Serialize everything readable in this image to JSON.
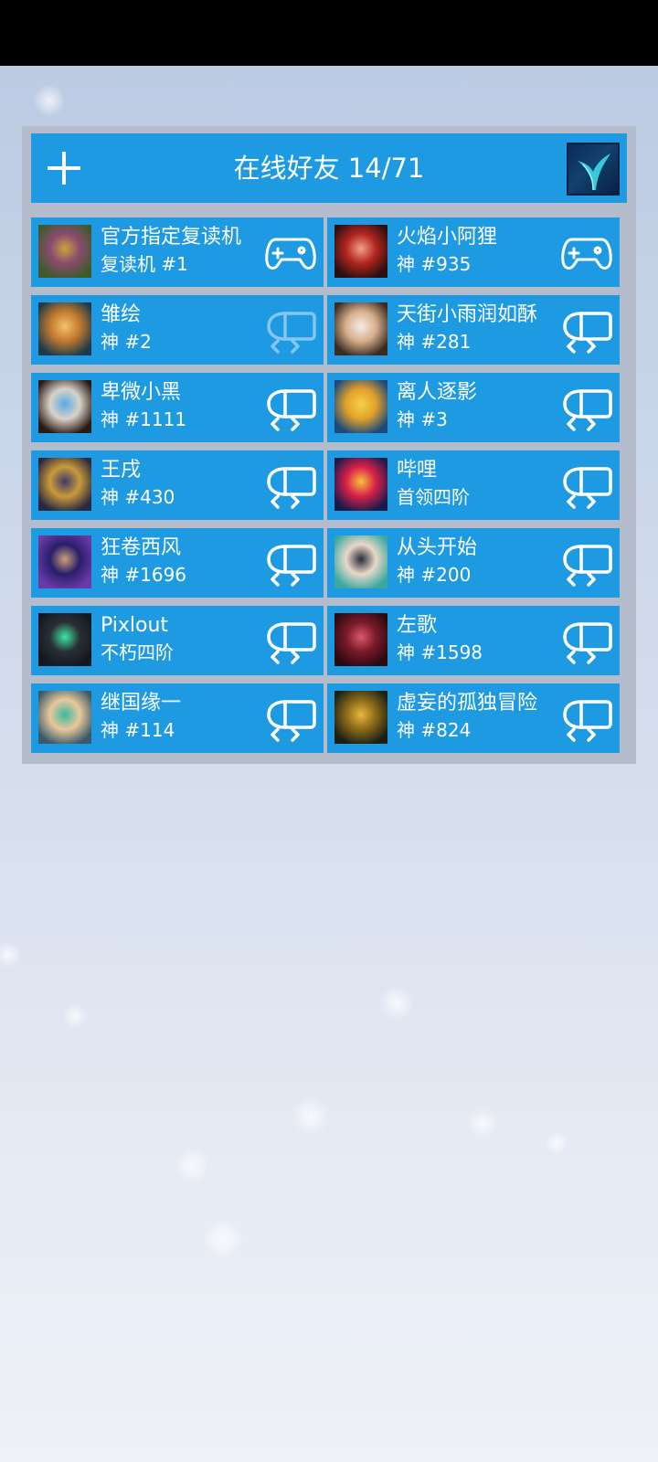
{
  "header": {
    "title": "在线好友 14/71"
  },
  "friends": [
    {
      "name": "官方指定复读机",
      "rank": "复读机 #1",
      "status_icon": "gamepad-icon",
      "avatar_colors": [
        "#3e5a2a",
        "#8a4b6e",
        "#c9a33c"
      ]
    },
    {
      "name": "火焰小阿狸",
      "rank": "神 #935",
      "status_icon": "gamepad-icon",
      "avatar_colors": [
        "#2a0f10",
        "#b3261e",
        "#f0a08a"
      ]
    },
    {
      "name": "雏绘",
      "rank": "神 #2",
      "status_icon": "vr-headset-icon",
      "status_dim": true,
      "avatar_colors": [
        "#1e3a4a",
        "#c27a2e",
        "#f3c26b"
      ]
    },
    {
      "name": "天街小雨润如酥",
      "rank": "神 #281",
      "status_icon": "vr-headset-icon",
      "avatar_colors": [
        "#3a2a20",
        "#d9b08c",
        "#f2ede8"
      ]
    },
    {
      "name": "卑微小黑",
      "rank": "神 #1111",
      "status_icon": "vr-headset-icon",
      "avatar_colors": [
        "#2a1a14",
        "#d8d2c8",
        "#5aa8e8"
      ]
    },
    {
      "name": "离人逐影",
      "rank": "神 #3",
      "status_icon": "vr-headset-icon",
      "avatar_colors": [
        "#1c4a7a",
        "#e3a12a",
        "#f5d04a"
      ]
    },
    {
      "name": "王戌",
      "rank": "神 #430",
      "status_icon": "vr-headset-icon",
      "avatar_colors": [
        "#2a2840",
        "#c99a3a",
        "#3d3a6a"
      ]
    },
    {
      "name": "哔哩",
      "rank": "首领四阶",
      "status_icon": "vr-headset-icon",
      "avatar_colors": [
        "#1a1a4a",
        "#d8204a",
        "#f6c23c"
      ]
    },
    {
      "name": "狂卷西风",
      "rank": "神 #1696",
      "status_icon": "vr-headset-icon",
      "avatar_colors": [
        "#6a3aa8",
        "#2a1e6a",
        "#c9a07a"
      ]
    },
    {
      "name": "从头开始",
      "rank": "神 #200",
      "status_icon": "vr-headset-icon",
      "avatar_colors": [
        "#3aa8a0",
        "#e8d8c8",
        "#2a2a3a"
      ]
    },
    {
      "name": "Pixlout",
      "rank": "不朽四阶",
      "status_icon": "vr-headset-icon",
      "avatar_colors": [
        "#14181e",
        "#2a2e36",
        "#3ce8a0"
      ]
    },
    {
      "name": "左歌",
      "rank": "神 #1598",
      "status_icon": "vr-headset-icon",
      "avatar_colors": [
        "#2a0a10",
        "#7a1a2a",
        "#d85a6a"
      ]
    },
    {
      "name": "继国缘一",
      "rank": "神 #114",
      "status_icon": "vr-headset-icon",
      "avatar_colors": [
        "#3a5a6a",
        "#e8c89a",
        "#3ab8a0"
      ]
    },
    {
      "name": "虚妄的孤独冒险",
      "rank": "神 #824",
      "status_icon": "vr-headset-icon",
      "avatar_colors": [
        "#1a1e14",
        "#8a6a1a",
        "#e8b83a"
      ]
    }
  ],
  "colors": {
    "card": "#1e9ae3",
    "panel": "#b4bccb",
    "status_bar": "#000000"
  }
}
